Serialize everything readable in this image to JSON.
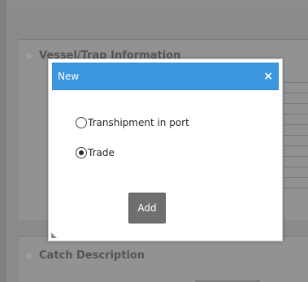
{
  "background": {
    "sections": [
      {
        "title": "Vessel/Trap Information"
      },
      {
        "title": "Catch Description"
      }
    ]
  },
  "dialog": {
    "title": "New",
    "close_glyph": "×",
    "options": [
      {
        "label": "Transhipment in port",
        "checked": false
      },
      {
        "label": "Trade",
        "checked": true
      }
    ],
    "add_label": "Add"
  },
  "colors": {
    "header": "#3c96e0",
    "add_button": "#6f6f6f",
    "overlay": "#808080"
  },
  "icons": {
    "section_toggle": "triangle-right-icon",
    "close": "close-icon",
    "resize": "resize-grip-icon"
  }
}
